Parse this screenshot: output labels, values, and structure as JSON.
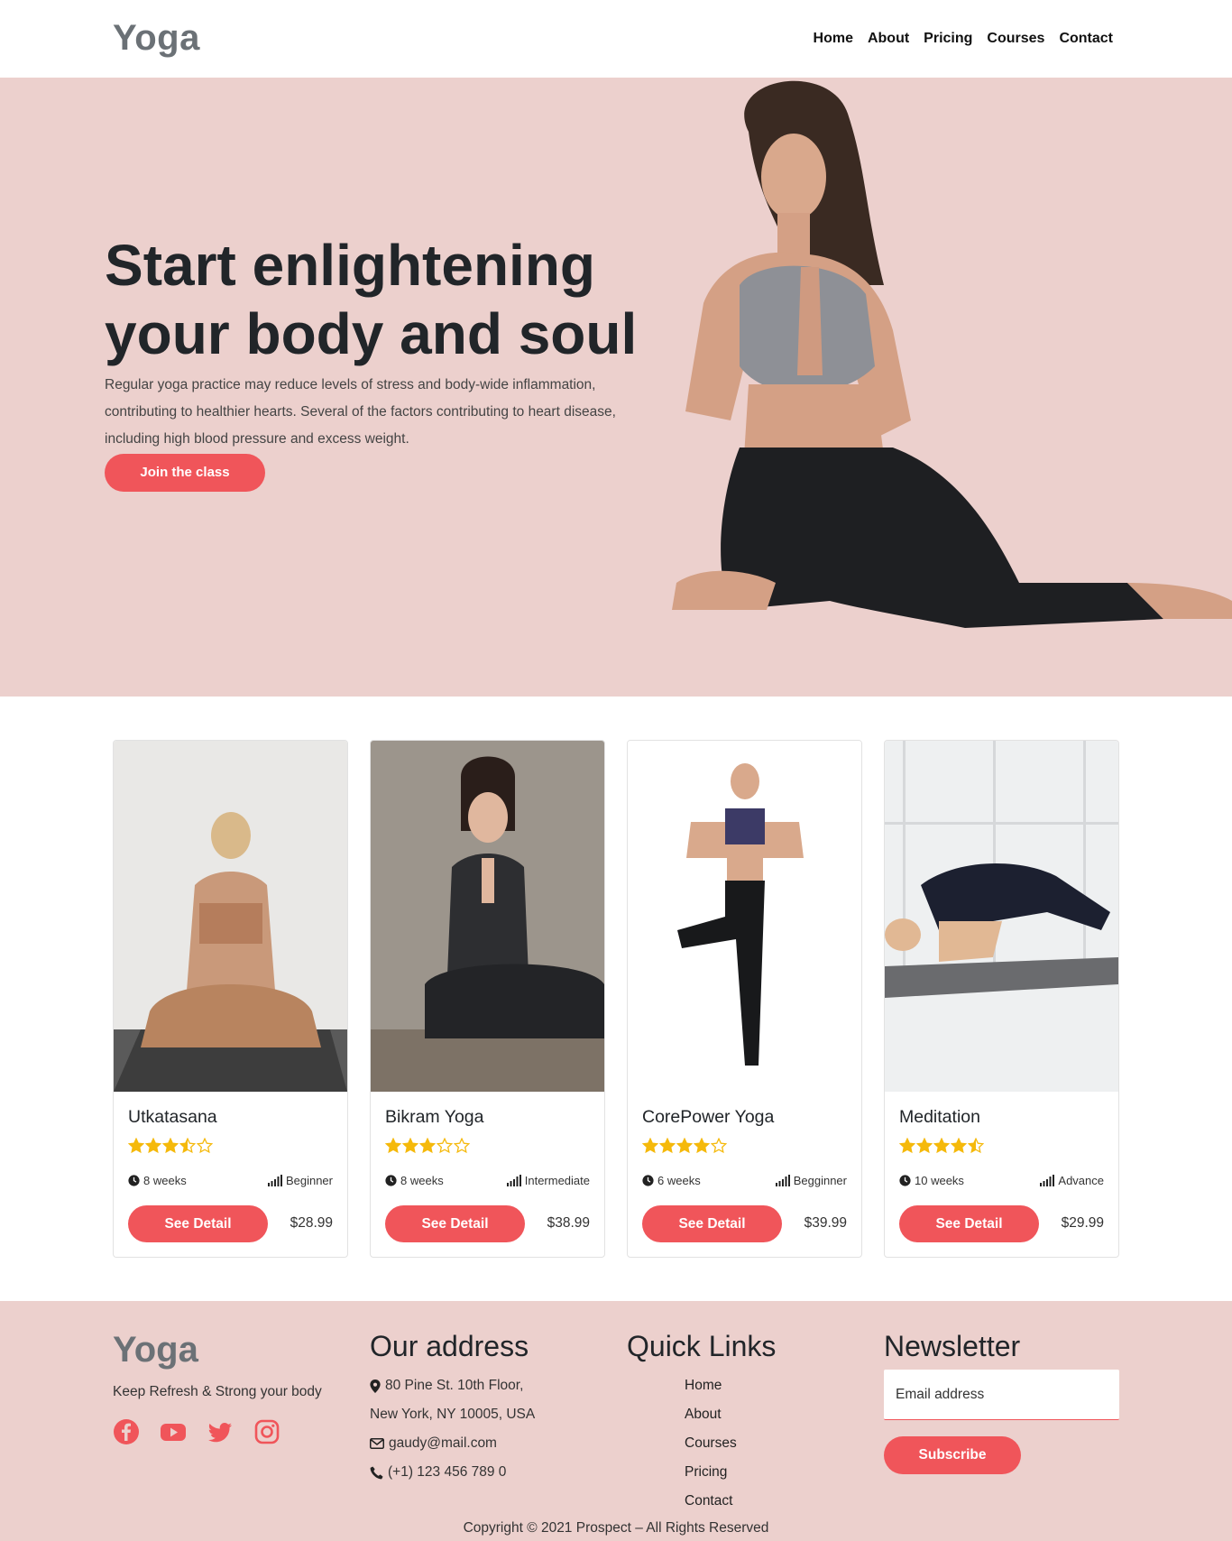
{
  "brand": {
    "logo": "Yoga"
  },
  "nav": {
    "items": [
      "Home",
      "About",
      "Pricing",
      "Courses",
      "Contact"
    ]
  },
  "hero": {
    "title_line1": "Start enlightening",
    "title_line2": "your body and soul",
    "text": "Regular yoga practice may reduce levels of stress and body-wide inflammation, contributing to healthier hearts. Several of the factors contributing to heart disease, including high blood pressure and excess weight.",
    "cta": "Join the class"
  },
  "courses": [
    {
      "title": "Utkatasana",
      "rating": 3.5,
      "duration": "8 weeks",
      "level": "Beginner",
      "button": "See Detail",
      "price": "$28.99"
    },
    {
      "title": "Bikram Yoga",
      "rating": 3,
      "duration": "8 weeks",
      "level": "Intermediate",
      "button": "See Detail",
      "price": "$38.99"
    },
    {
      "title": "CorePower Yoga",
      "rating": 4,
      "duration": "6 weeks",
      "level": "Begginner",
      "button": "See Detail",
      "price": "$39.99"
    },
    {
      "title": "Meditation",
      "rating": 4.5,
      "duration": "10 weeks",
      "level": "Advance",
      "button": "See Detail",
      "price": "$29.99"
    }
  ],
  "footer": {
    "logo": "Yoga",
    "tagline": "Keep Refresh & Strong your body",
    "address_title": "Our address",
    "address_line1": "80 Pine St. 10th Floor,",
    "address_line2": "New York, NY 10005, USA",
    "email": "gaudy@mail.com",
    "phone": "(+1) 123 456 789 0",
    "links_title": "Quick Links",
    "links": [
      "Home",
      "About",
      "Courses",
      "Pricing",
      "Contact"
    ],
    "newsletter_title": "Newsletter",
    "email_placeholder": "Email address",
    "subscribe": "Subscribe",
    "copyright": "Copyright © 2021 Prospect – All Rights Reserved"
  },
  "colors": {
    "accent": "#f0555a",
    "hero_bg": "#ecd0cd",
    "star": "#f5b90b",
    "logo": "#6b7176"
  },
  "icons": [
    "clock-icon",
    "signal-icon",
    "map-pin-icon",
    "envelope-icon",
    "phone-icon",
    "facebook-icon",
    "youtube-icon",
    "twitter-icon",
    "instagram-icon",
    "star-icon"
  ]
}
